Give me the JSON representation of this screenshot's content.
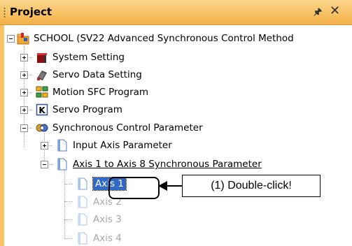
{
  "panel": {
    "title": "Project",
    "pin_glyph": "ℵ",
    "close_glyph": "×"
  },
  "tree": {
    "root": "SCHOOL (SV22 Advanced Synchronous Control Method",
    "items": [
      {
        "label": "System Setting",
        "icon": "system-setting-icon"
      },
      {
        "label": "Servo Data Setting",
        "icon": "servo-data-icon"
      },
      {
        "label": "Motion SFC Program",
        "icon": "motion-sfc-icon"
      },
      {
        "label": "Servo Program",
        "icon": "servo-program-icon"
      },
      {
        "label": "Synchronous Control Parameter",
        "icon": "sync-control-icon"
      }
    ],
    "sync_children": [
      {
        "label": "Input Axis Parameter"
      },
      {
        "label": "Axis 1 to Axis 8  Synchronous Parameter"
      }
    ],
    "axes": [
      "Axis 1",
      "Axis 2",
      "Axis 3",
      "Axis 4"
    ]
  },
  "callout": {
    "text": "(1) Double-click!"
  },
  "colors": {
    "titlebar": "#f8c265",
    "selection": "#316ac5"
  }
}
